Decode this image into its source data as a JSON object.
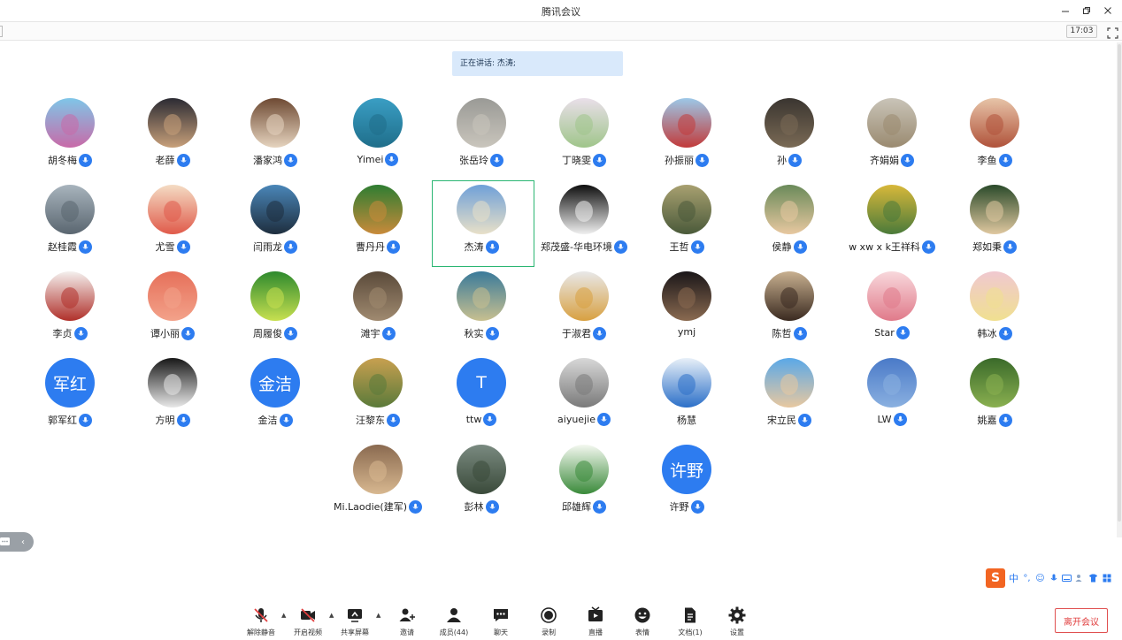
{
  "window": {
    "title": "腾讯会议"
  },
  "status": {
    "clock": "17:03"
  },
  "speaking_banner": "正在讲话: 杰涛;",
  "participants": [
    {
      "name": "胡冬梅"
    },
    {
      "name": "老薛"
    },
    {
      "name": "潘家鸿"
    },
    {
      "name": "Yimei"
    },
    {
      "name": "张岳玲"
    },
    {
      "name": "丁晓雯"
    },
    {
      "name": "孙振丽"
    },
    {
      "name": "孙"
    },
    {
      "name": "齐娟娟"
    },
    {
      "name": "李鱼"
    },
    {
      "name": "赵桂霞"
    },
    {
      "name": "尤雪"
    },
    {
      "name": "闫雨龙"
    },
    {
      "name": "曹丹丹"
    },
    {
      "name": "杰涛"
    },
    {
      "name": "郑茂盛-华电环境"
    },
    {
      "name": "王哲"
    },
    {
      "name": "侯静"
    },
    {
      "name": "w xw x k王祥科"
    },
    {
      "name": "郑如秉"
    },
    {
      "name": "李贞"
    },
    {
      "name": "谭小丽"
    },
    {
      "name": "周履俊"
    },
    {
      "name": "滩宇"
    },
    {
      "name": "秋实"
    },
    {
      "name": "于淑君"
    },
    {
      "name": "ymj"
    },
    {
      "name": "陈哲"
    },
    {
      "name": "Star"
    },
    {
      "name": "韩冰"
    },
    {
      "name": "郭军红",
      "avatar_text": "军红"
    },
    {
      "name": "方明"
    },
    {
      "name": "金洁",
      "avatar_text": "金洁"
    },
    {
      "name": "汪黎东"
    },
    {
      "name": "ttw",
      "avatar_text": "T"
    },
    {
      "name": "aiyuejie"
    },
    {
      "name": "杨慧"
    },
    {
      "name": "宋立民"
    },
    {
      "name": "LW"
    },
    {
      "name": "姚嘉"
    },
    {
      "name": "Mi.Laodie(建军)"
    },
    {
      "name": "彭林"
    },
    {
      "name": "邱雄辉"
    },
    {
      "name": "许野",
      "avatar_text": "许野"
    }
  ],
  "ime": {
    "mode": "中",
    "punct": "°,"
  },
  "toolbar": {
    "items": [
      {
        "label": "解除静音",
        "icon": "mic-muted-icon"
      },
      {
        "label": "开启视频",
        "icon": "camera-off-icon"
      },
      {
        "label": "共享屏幕",
        "icon": "screen-share-icon"
      },
      {
        "label": "邀请",
        "icon": "invite-icon"
      },
      {
        "label": "成员(44)",
        "icon": "members-icon"
      },
      {
        "label": "聊天",
        "icon": "chat-icon"
      },
      {
        "label": "录制",
        "icon": "record-icon"
      },
      {
        "label": "直播",
        "icon": "live-icon"
      },
      {
        "label": "表情",
        "icon": "emoji-icon"
      },
      {
        "label": "文档(1)",
        "icon": "document-icon"
      },
      {
        "label": "设置",
        "icon": "settings-icon"
      }
    ],
    "leave_label": "离开会议"
  },
  "colors": {
    "accent": "#2d7cf0",
    "selected_border": "#2bb673",
    "leave": "#e03d3d",
    "banner_bg": "#d9e9fb"
  }
}
